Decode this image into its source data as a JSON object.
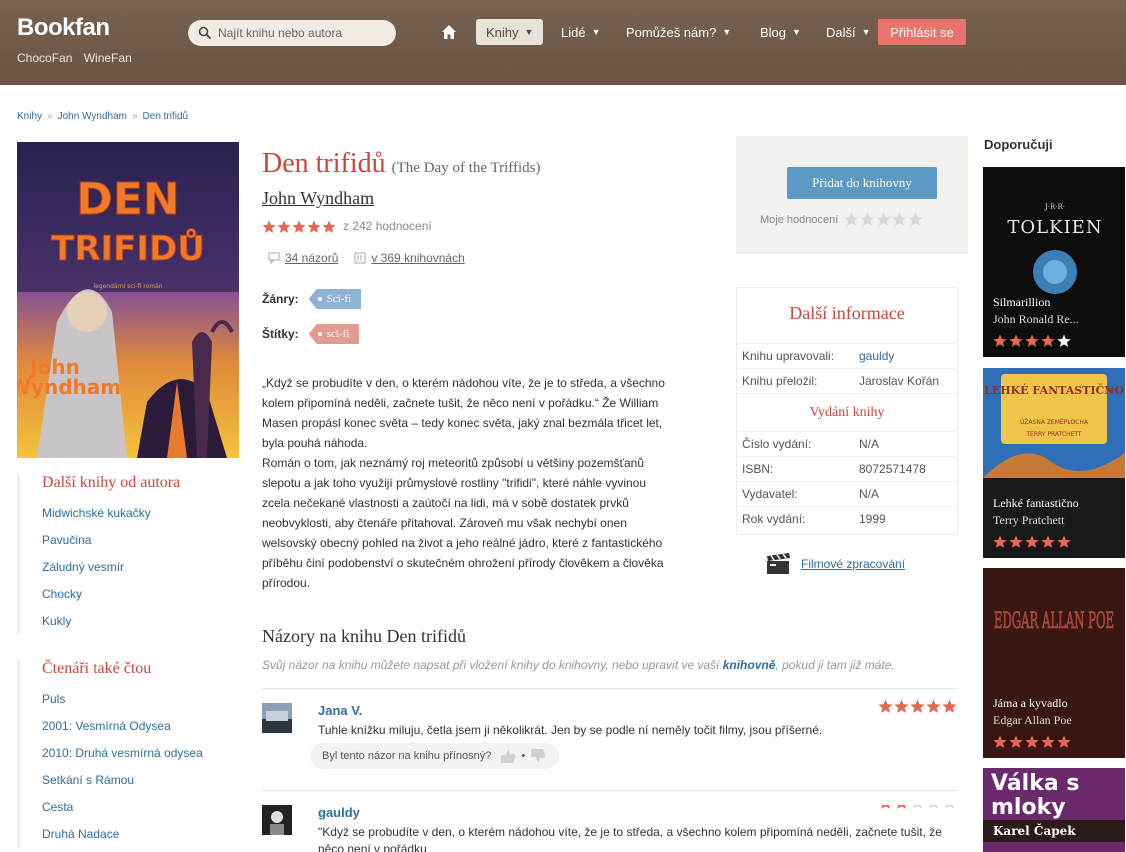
{
  "header": {
    "logo": "Bookfan",
    "sub_links": [
      "ChocoFan",
      "WineFan"
    ],
    "search_placeholder": "Najít knihu nebo autora",
    "nav": {
      "knihy": "Knihy",
      "lide": "Lidé",
      "pomuzes": "Pomůžeš nám?",
      "blog": "Blog",
      "dalsi": "Další",
      "login": "Přihlásit se"
    }
  },
  "breadcrumb": [
    "Knihy",
    "John Wyndham",
    "Den trifidů"
  ],
  "cover": {
    "title_line1": "DEN",
    "title_line2": "TRIFIDŮ",
    "subtitle": "legendární sci-fi román",
    "author_line1": "John",
    "author_line2": "Wyndham"
  },
  "book": {
    "title": "Den trifidů",
    "original_title": "(The Day of the Triffids)",
    "author": "John Wyndham",
    "rating_stars": 5,
    "rating_count": "z 242 hodnocení",
    "opinions": "34 názorů",
    "libraries": "v 369 knihovnách",
    "genres_label": "Žánry:",
    "genre": "Sci-fi",
    "tags_label": "Štítky:",
    "tag": "sci-fi",
    "description": "„Když se probudíte v den, o kterém nádohou víte, že je to středa, a všechno kolem připomíná neděli, začnete tušit, že něco není v pořádku.“ Že William Masen propásl konec světa – tedy konec světa, jaký znal bezmála třicet let, byla pouhá náhoda.\nRomán o tom, jak neznámý roj meteoritů způsobí u většiny pozemšťanů slepotu a jak toho využijí průmyslové rostliny \"trifidi\", které náhle vyvinou zcela nečekané vlastnosti a zaútočí na lidi, má v sobě dostatek prvků neobvyklosti, aby čtenáře přitahoval. Zároveň mu však nechybí onen welsovský obecný pohled na život a jeho reálné jádro, které z fantastického příběhu činí podobenství o skutečném ohrožení přírody člověkem a člověka přírodou."
  },
  "sidebar": {
    "more_by_author_title": "Další knihy od autora",
    "more_by_author": [
      "Midwichské kukačky",
      "Pavučina",
      "Záludný vesmír",
      "Chocky",
      "Kukly"
    ],
    "readers_also_title": "Čtenáři také čtou",
    "readers_also": [
      "Puls",
      "2001: Vesmírná Odysea",
      "2010: Druhá vesmírná odysea",
      "Setkání s Rámou",
      "Cesta",
      "Druhá Nadace"
    ]
  },
  "actions": {
    "add_button": "Přidat do knihovny",
    "my_rating_label": "Moje hodnocení"
  },
  "info": {
    "title": "Další informace",
    "rows1": [
      {
        "k": "Knihu upravovali:",
        "v": "gauldy"
      },
      {
        "k": "Knihu přeložil:",
        "v": "Jaroslav Kořán"
      }
    ],
    "edition_title": "Vydání knihy",
    "rows2": [
      {
        "k": "Číslo vydání:",
        "v": "N/A"
      },
      {
        "k": "ISBN:",
        "v": "8072571478"
      },
      {
        "k": "Vydavatel:",
        "v": "N/A"
      },
      {
        "k": "Rok vydání:",
        "v": "1999"
      }
    ],
    "film_link": "Filmové zpracování"
  },
  "reviews": {
    "title": "Názory na knihu Den trifidů",
    "note_before": "Svůj názor na knihu můžete napsat při vložení knihy do knihovny, nebo upravit ve vaší ",
    "note_link": "knihovně",
    "note_after": ", pokud ji tam již máte.",
    "items": [
      {
        "name": "Jana V.",
        "stars": 5,
        "text": "Tuhle knížku miluju, četla jsem ji několikrát. Jen by se podle ní neměly točit filmy, jsou příšerné.",
        "helpful": "Byl tento názor na knihu přínosný?"
      },
      {
        "name": "gauldy",
        "stars": 2,
        "text": "\"Když se probudíte v den, o kterém nádohou víte, že je to středa, a všechno kolem připomíná neděli, začnete tušit, že něco není v pořádku"
      }
    ]
  },
  "recommend": {
    "title": "Doporučuji",
    "items": [
      {
        "cover_text": "TOLKIEN",
        "cover_small": "J·R·R·",
        "title": "Silmarillion",
        "author": "John Ronald Re...",
        "stars": 4
      },
      {
        "cover_text": "LEHKÉ FANTASTIČNO",
        "cover_small": "ÚŽASNÁ ZEMĚPLOCHA",
        "cover_author": "TERRY PRATCHETT",
        "title": "Lehké fantastično",
        "author": "Terry Pratchett",
        "stars": 5
      },
      {
        "cover_text": "EDGAR ALLAN POE",
        "title": "Jáma a kyvadlo",
        "author": "Edgar Allan Poe",
        "stars": 5
      },
      {
        "cover_text": "Válka s mloky",
        "cover_author": "Karel Čapek"
      }
    ]
  },
  "colors": {
    "accent": "#c9483d",
    "link": "#2e6f9b",
    "header": "#6f5a4b",
    "star": "#e8674f"
  }
}
